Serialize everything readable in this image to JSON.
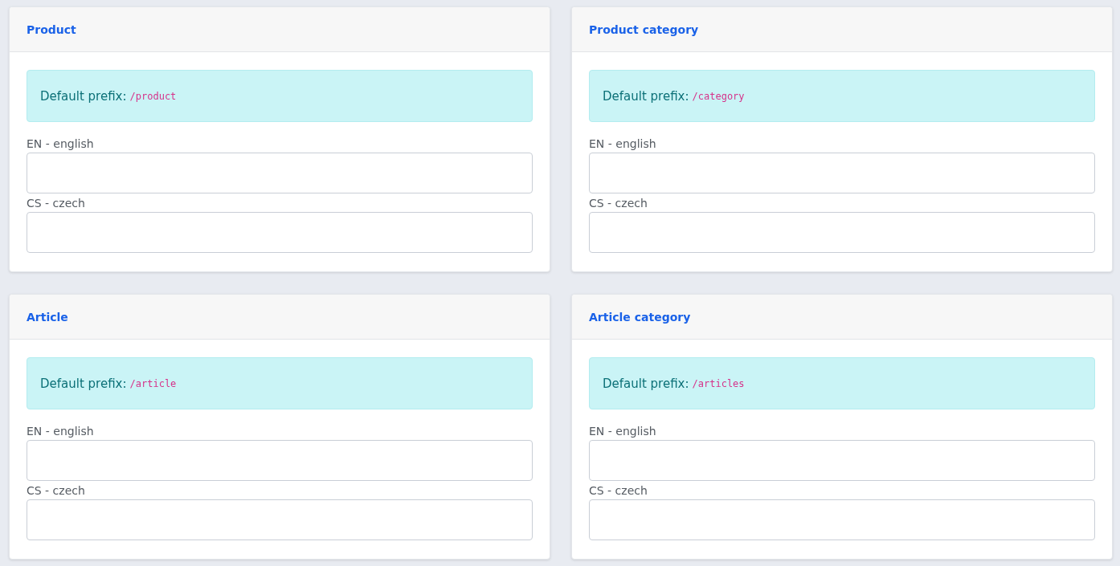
{
  "cards": [
    {
      "title": "Product",
      "prefix_label": "Default prefix:",
      "prefix": "/product",
      "fields": [
        {
          "label": "EN - english"
        },
        {
          "label": "CS - czech"
        }
      ]
    },
    {
      "title": "Product category",
      "prefix_label": "Default prefix:",
      "prefix": "/category",
      "fields": [
        {
          "label": "EN - english"
        },
        {
          "label": "CS - czech"
        }
      ]
    },
    {
      "title": "Article",
      "prefix_label": "Default prefix:",
      "prefix": "/article",
      "fields": [
        {
          "label": "EN - english"
        },
        {
          "label": "CS - czech"
        }
      ]
    },
    {
      "title": "Article category",
      "prefix_label": "Default prefix:",
      "prefix": "/articles",
      "fields": [
        {
          "label": "EN - english"
        },
        {
          "label": "CS - czech"
        }
      ]
    }
  ]
}
